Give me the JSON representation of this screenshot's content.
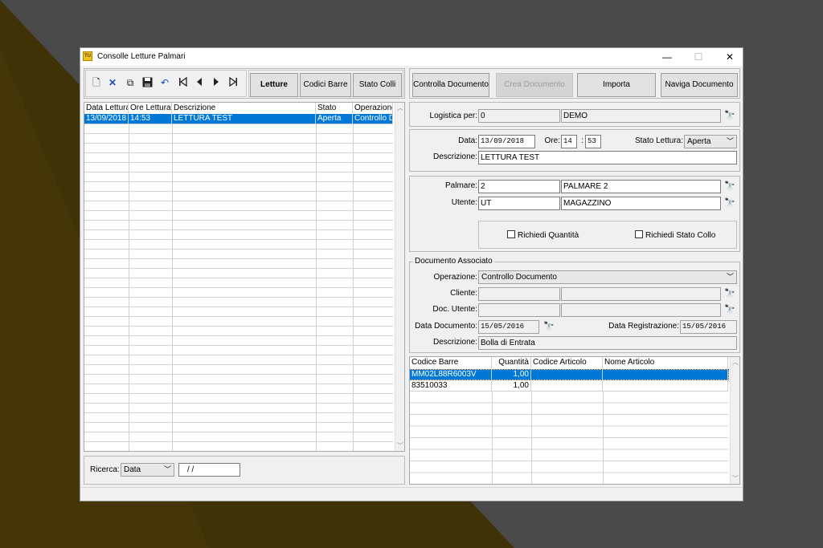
{
  "window": {
    "icon_text": "TU",
    "title": "Consolle Letture Palmari",
    "controls": {
      "minimize": "—",
      "maximize": "☐",
      "close": "✕"
    }
  },
  "toolbar": {
    "icons": [
      "new-icon",
      "delete-icon",
      "copy-icon",
      "save-icon",
      "undo-icon",
      "first-record-icon",
      "prev-record-icon",
      "next-record-icon",
      "last-record-icon"
    ],
    "tabs": {
      "letture": "Letture",
      "codici_barre": "Codici Barre",
      "stato_colli": "Stato Colli"
    }
  },
  "actions": {
    "controlla": "Controlla Documento",
    "crea": "Crea Documento",
    "importa": "Importa",
    "naviga": "Naviga Documento"
  },
  "letture_grid": {
    "columns": [
      "Data Lettura",
      "Ore Lettura",
      "Descrizione",
      "Stato",
      "Operazione"
    ],
    "rows": [
      {
        "data": "13/09/2018",
        "ore": "14:53",
        "descrizione": "LETTURA TEST",
        "stato": "Aperta",
        "operazione": "Controllo Do"
      }
    ]
  },
  "search": {
    "label": "Ricerca:",
    "field": "Data",
    "value": "  /  /"
  },
  "logistica": {
    "label": "Logistica per:",
    "code": "0",
    "name": "DEMO"
  },
  "lettura": {
    "data_label": "Data:",
    "data": "13/09/2018",
    "ore_label": "Ore:",
    "ore_h": "14",
    "ore_sep": ":",
    "ore_m": "53",
    "stato_label": "Stato Lettura:",
    "stato": "Aperta",
    "descr_label": "Descrizione:",
    "descrizione": "LETTURA TEST"
  },
  "palmare": {
    "palmare_label": "Palmare:",
    "palmare_code": "2",
    "palmare_name": "PALMARE 2",
    "utente_label": "Utente:",
    "utente_code": "UT",
    "utente_name": "MAGAZZINO",
    "chk_quantita": "Richiedi Quantità",
    "chk_stato_collo": "Richiedi Stato Collo"
  },
  "documento": {
    "group_title": "Documento Associato",
    "operazione_label": "Operazione:",
    "operazione": "Controllo Documento",
    "cliente_label": "Cliente:",
    "doc_utente_label": "Doc. Utente:",
    "data_doc_label": "Data Documento:",
    "data_doc": "15/05/2016",
    "data_reg_label": "Data Registrazione:",
    "data_reg": "15/05/2016",
    "descr_label": "Descrizione:",
    "descrizione": "Bolla di Entrata"
  },
  "barcode_grid": {
    "columns": [
      "Codice Barre",
      "Quantità",
      "Codice Articolo",
      "Nome Articolo"
    ],
    "rows": [
      {
        "codice": "MM02L88R6003V",
        "quantita": "1,00",
        "articolo": "",
        "nome": ""
      },
      {
        "codice": "83510033",
        "quantita": "1,00",
        "articolo": "",
        "nome": ""
      }
    ]
  }
}
